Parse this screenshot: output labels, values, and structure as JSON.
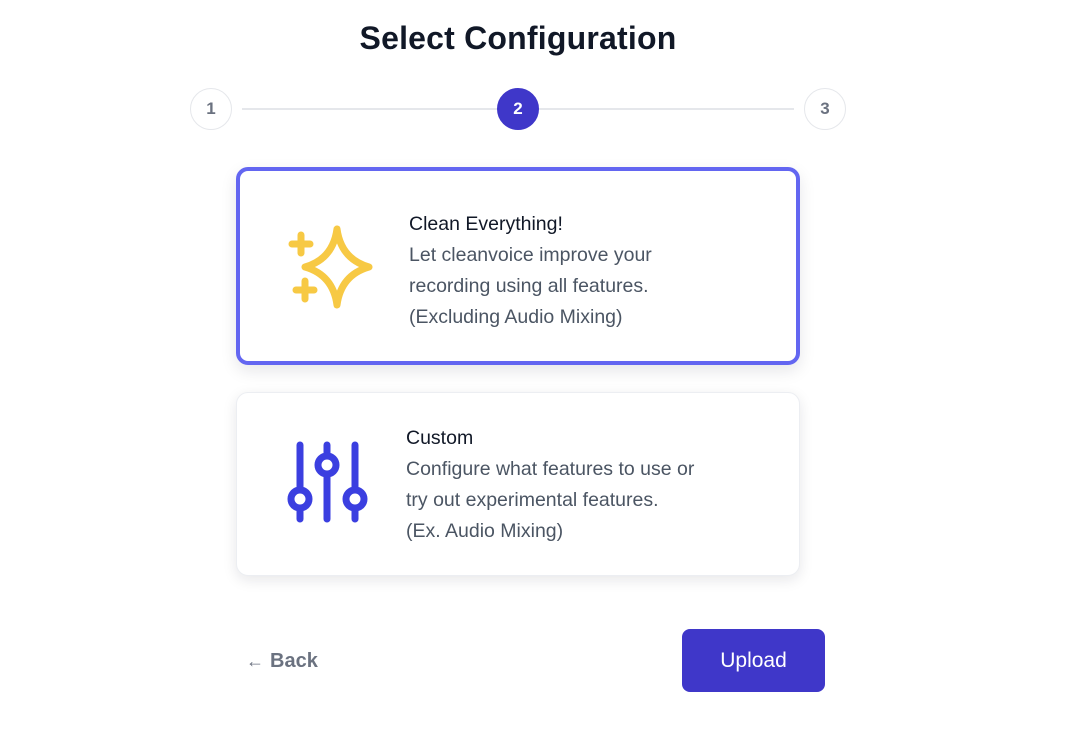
{
  "header": {
    "title": "Select Configuration"
  },
  "stepper": {
    "steps": [
      {
        "label": "1",
        "state": "inactive"
      },
      {
        "label": "2",
        "state": "active"
      },
      {
        "label": "3",
        "state": "inactive"
      }
    ]
  },
  "options": [
    {
      "title": "Clean Everything!",
      "description": [
        "Let cleanvoice improve your",
        "recording using all features.",
        "(Excluding Audio Mixing)"
      ],
      "icon": "sparkles-icon",
      "selected": true
    },
    {
      "title": "Custom",
      "description": [
        "Configure what features to use or",
        "try out experimental features.",
        "(Ex. Audio Mixing)"
      ],
      "icon": "sliders-icon",
      "selected": false
    }
  ],
  "actions": {
    "back_arrow": "←",
    "back_label": "Back",
    "upload_label": "Upload"
  },
  "colors": {
    "primary": "#3f37c9",
    "selected_border": "#6366f1",
    "sparkle": "#f7c944",
    "slider_icon": "#3b3fe0"
  }
}
